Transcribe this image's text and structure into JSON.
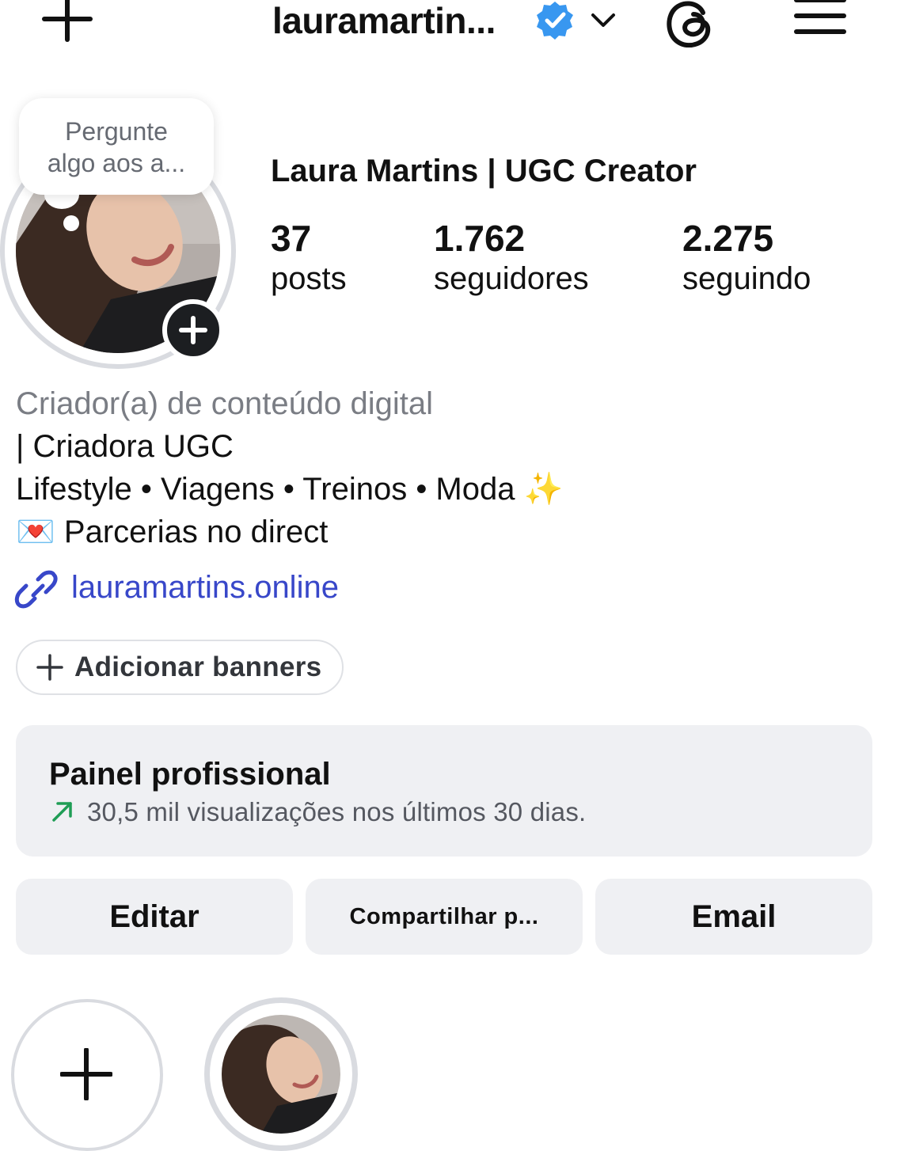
{
  "header": {
    "username": "lauramartin...",
    "icons": {
      "create": "plus-icon",
      "verified": "verified-badge-icon",
      "switch_account": "chevron-down-icon",
      "threads": "threads-icon",
      "menu": "hamburger-menu-icon"
    }
  },
  "profile": {
    "note_bubble": {
      "line1": "Pergunte",
      "line2": "algo aos a..."
    },
    "display_name": "Laura Martins | UGC Creator",
    "stats": [
      {
        "value": "37",
        "label": "posts"
      },
      {
        "value": "1.762",
        "label": "seguidores"
      },
      {
        "value": "2.275",
        "label": "seguindo"
      }
    ]
  },
  "bio": {
    "category": "Criador(a) de conteúdo digital",
    "lines": [
      "| Criadora UGC",
      "Lifestyle • Viagens • Treinos • Moda ✨",
      "💌 Parcerias no direct"
    ],
    "link": "lauramartins.online"
  },
  "banner_button": {
    "label": "Adicionar banners"
  },
  "professional_panel": {
    "title": "Painel profissional",
    "subtitle": "30,5 mil visualizações nos últimos 30 dias.",
    "trend_color": "#1f9d55"
  },
  "actions": {
    "edit": "Editar",
    "share": "Compartilhar p...",
    "email": "Email"
  },
  "highlights": {
    "new_icon": "plus-icon"
  },
  "colors": {
    "link": "#3847c9",
    "verified": "#3897f0",
    "button_bg": "#eff0f3"
  }
}
